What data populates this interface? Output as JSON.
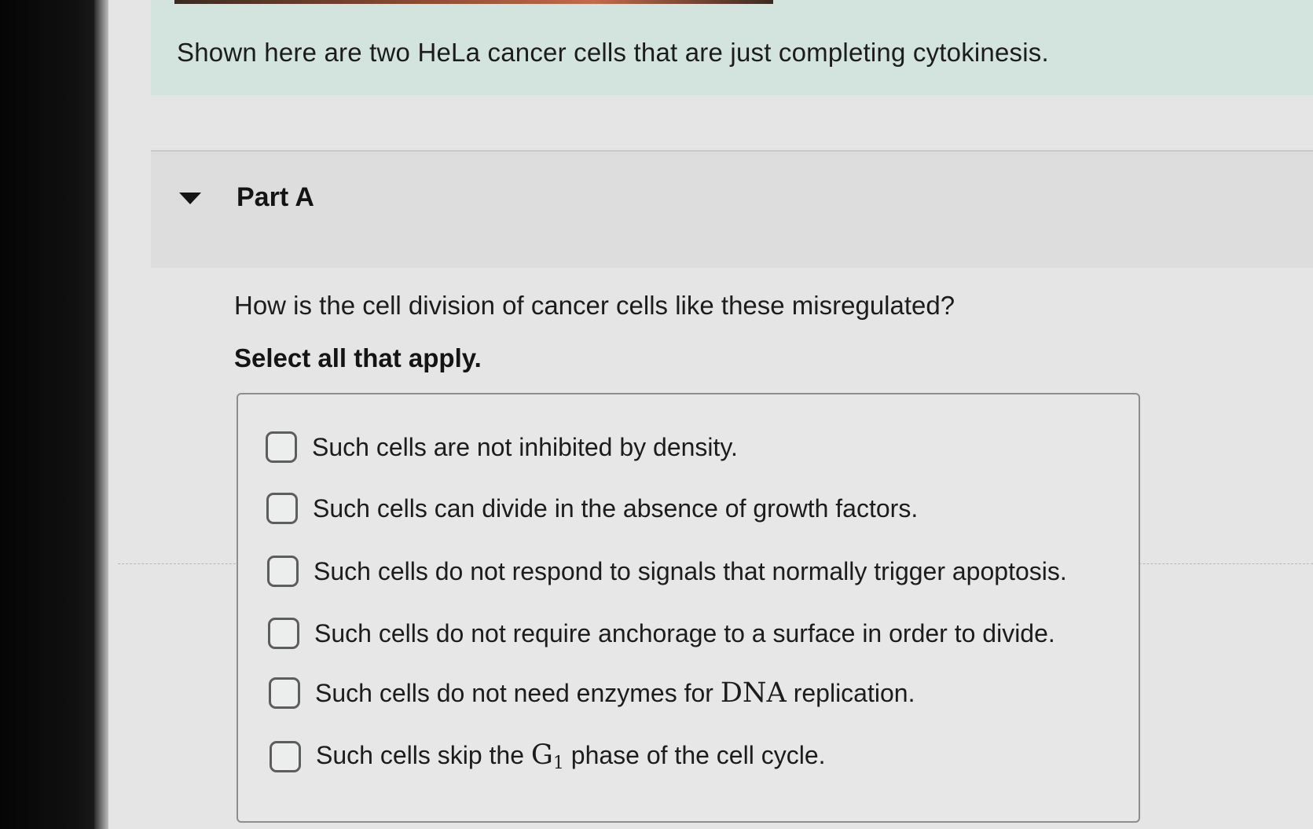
{
  "intro": {
    "text": "Shown here are two HeLa cancer cells that are just completing cytokinesis."
  },
  "part": {
    "title": "Part A"
  },
  "question": {
    "prompt": "How is the cell division of cancer cells like these misregulated?",
    "instruction": "Select all that apply."
  },
  "options": [
    {
      "text": "Such cells are not inhibited by density.",
      "checked": false
    },
    {
      "text": "Such cells can divide in the absence of growth factors.",
      "checked": false
    },
    {
      "text": "Such cells do not respond to signals that normally trigger apoptosis.",
      "checked": false
    },
    {
      "text": "Such cells do not require anchorage to a surface in order to divide.",
      "checked": false
    },
    {
      "text_before": "Such cells do not need enzymes for",
      "math": "DNA",
      "text_after": "replication.",
      "checked": false
    },
    {
      "text_before": "Such cells skip the",
      "math": "G",
      "math_sub": "1",
      "text_after": "phase of the cell cycle.",
      "checked": false
    }
  ],
  "colors": {
    "intro_bg": "#d3e3de",
    "part_header_bg": "#dcdddc",
    "page_bg": "#e4e5e4"
  },
  "icons": {
    "collapse": "caret-down-icon",
    "option": "checkbox-icon"
  }
}
